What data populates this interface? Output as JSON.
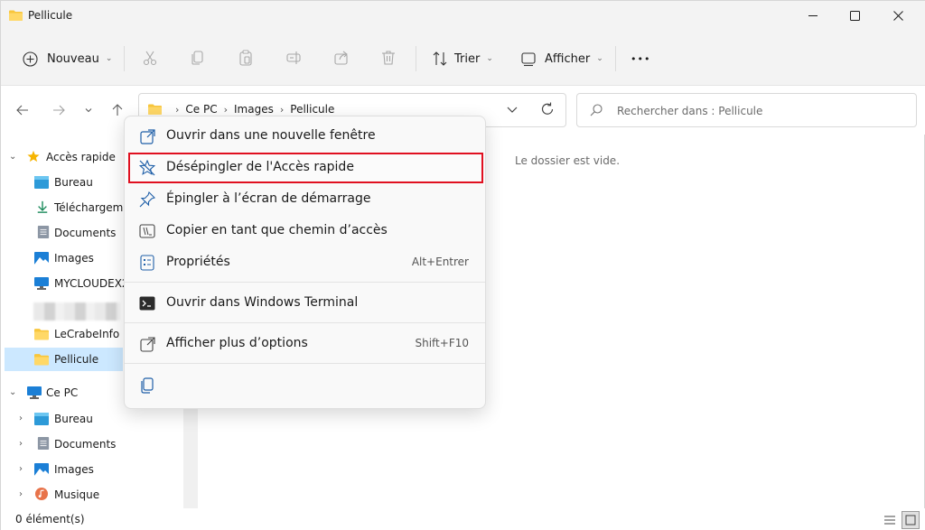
{
  "window": {
    "title": "Pellicule"
  },
  "toolbar": {
    "new_label": "Nouveau",
    "sort_label": "Trier",
    "view_label": "Afficher",
    "more_label": "•••"
  },
  "address": {
    "crumbs": [
      "Ce PC",
      "Images",
      "Pellicule"
    ]
  },
  "search": {
    "placeholder": "Rechercher dans : Pellicule"
  },
  "sidebar": {
    "quick_access": "Accès rapide",
    "items": [
      "Bureau",
      "Téléchargements",
      "Documents",
      "Images",
      "MYCLOUDEX2",
      "LeCrabeInfo",
      "Pellicule"
    ],
    "this_pc": "Ce PC",
    "pc_items": [
      "Bureau",
      "Documents",
      "Images",
      "Musique"
    ]
  },
  "content": {
    "empty_message": "Le dossier est vide."
  },
  "status": {
    "count": "0 élément(s)"
  },
  "context_menu": {
    "items": [
      {
        "label": "Ouvrir dans une nouvelle fenêtre",
        "shortcut": ""
      },
      {
        "label": "Désépingler de l'Accès rapide",
        "shortcut": "",
        "highlighted": true
      },
      {
        "label": "Épingler à l’écran de démarrage",
        "shortcut": ""
      },
      {
        "label": "Copier en tant que chemin d’accès",
        "shortcut": ""
      },
      {
        "label": "Propriétés",
        "shortcut": "Alt+Entrer"
      },
      {
        "label": "Ouvrir dans Windows Terminal",
        "shortcut": ""
      },
      {
        "label": "Afficher plus d’options",
        "shortcut": "Shift+F10"
      }
    ]
  },
  "colors": {
    "accent": "#0067c0",
    "highlight_border": "#e01020",
    "selected_bg": "#cce8ff",
    "folder_yellow": "#f8c63c"
  }
}
